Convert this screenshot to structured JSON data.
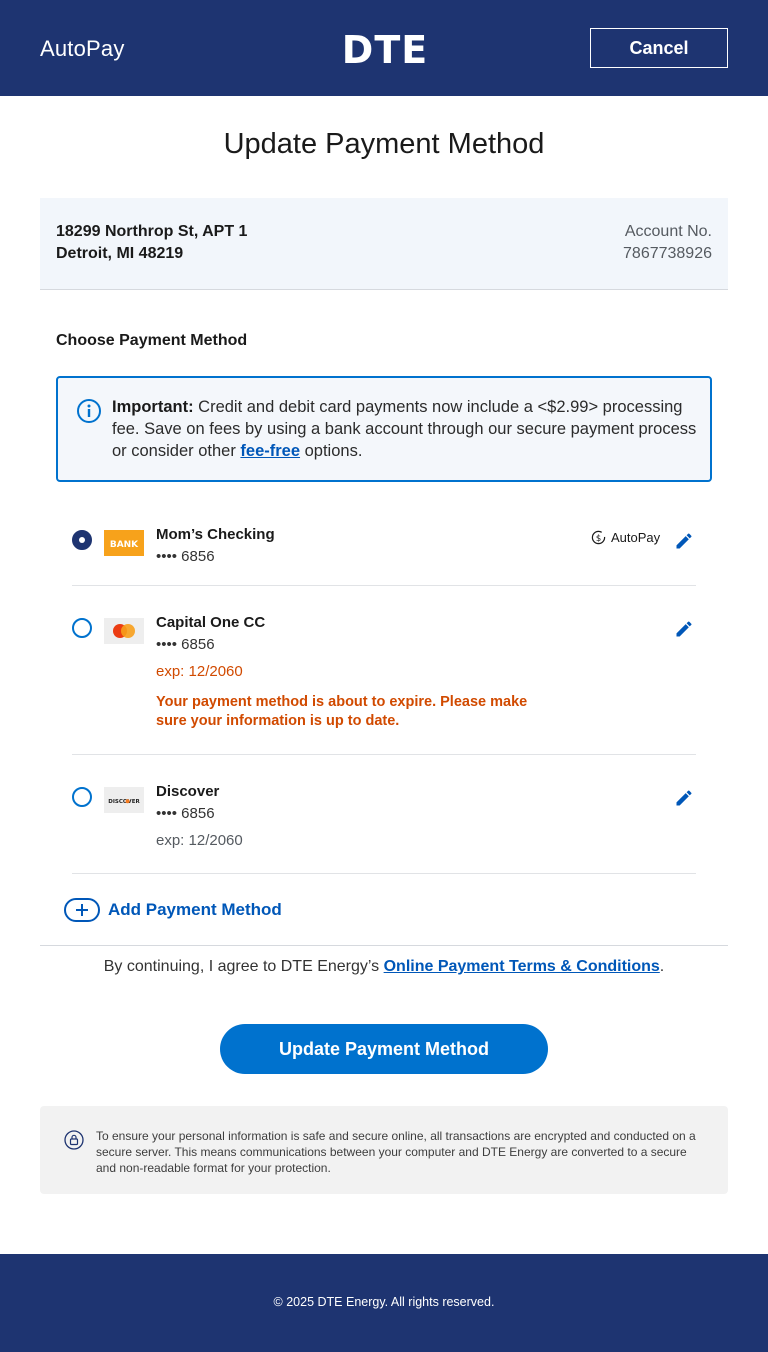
{
  "header": {
    "title": "AutoPay",
    "logo_text": "DTE",
    "cancel_label": "Cancel"
  },
  "page_title": "Update Payment Method",
  "account": {
    "address_line1": "18299 Northrop St, APT 1",
    "address_line2": "Detroit, MI 48219",
    "account_label": "Account No.",
    "account_number": "7867738926"
  },
  "section_label": "Choose Payment Method",
  "notice": {
    "strong": "Important:",
    "text_before": " Credit and debit card payments now include a <$2.99> processing fee. Save on fees by using a bank account through our secure payment process or consider other ",
    "link": "fee-free",
    "text_after": " options."
  },
  "payment_methods": [
    {
      "name": "Mom’s Checking",
      "masked": "•••• 6856",
      "logo": "BANK",
      "selected": true,
      "autopay_label": "AutoPay"
    },
    {
      "name": "Capital One CC",
      "masked": "•••• 6856",
      "logo": "mastercard",
      "expiry": "exp: 12/2060",
      "warning": "Your payment method is about to expire. Please make sure your information is up to date.",
      "selected": false
    },
    {
      "name": "Discover",
      "masked": "•••• 6856",
      "logo": "DISCOVER",
      "expiry": "exp: 12/2060",
      "selected": false
    }
  ],
  "add_payment_label": "Add Payment Method",
  "terms": {
    "prefix": "By continuing, I agree to DTE Energy’s ",
    "link": "Online Payment Terms & Conditions",
    "suffix": "."
  },
  "submit_label": "Update Payment Method",
  "security_text": "To ensure your personal information is safe and secure online, all transactions are encrypted and conducted on a secure server. This means communications between your computer and DTE Energy are converted to a secure and non-readable format for your protection.",
  "footer_text": "© 2025 DTE Energy. All rights reserved.",
  "colors": {
    "brand_navy": "#1e3471",
    "primary_blue": "#0072ce",
    "link_blue": "#0057b8",
    "warning_orange": "#d14a00",
    "bank_orange": "#f7a21b"
  }
}
